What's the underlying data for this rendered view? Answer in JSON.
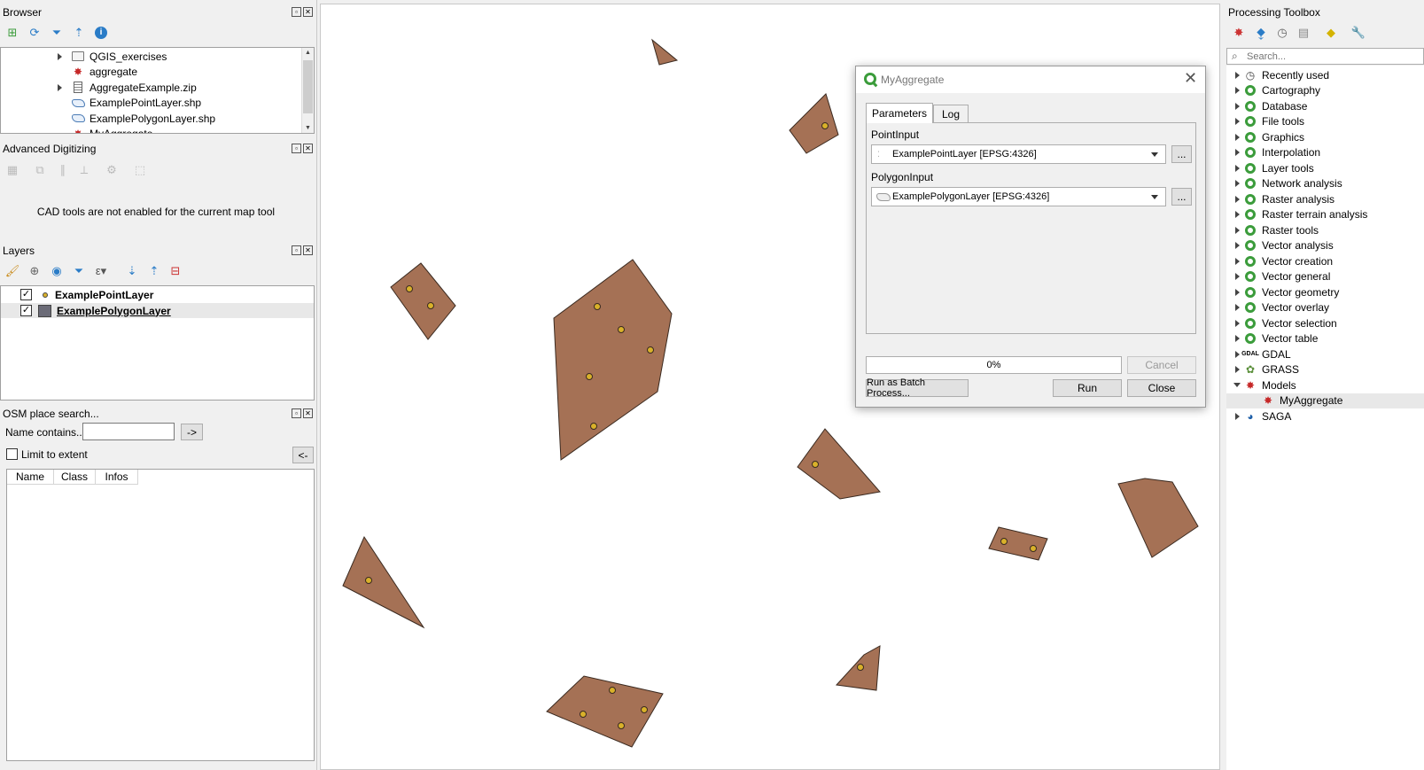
{
  "colors": {
    "polygon_fill": "#a57155",
    "point_fill": "#d9b12a",
    "accent_green": "#3b9c3b",
    "panel_bg": "#f0f0f0"
  },
  "browser": {
    "title": "Browser",
    "items": [
      {
        "label": "QGIS_exercises",
        "icon": "folder-icon",
        "expandable": true
      },
      {
        "label": "aggregate",
        "icon": "model-icon",
        "expandable": false
      },
      {
        "label": "AggregateExample.zip",
        "icon": "zip-icon",
        "expandable": true
      },
      {
        "label": "ExamplePointLayer.shp",
        "icon": "vector-icon",
        "expandable": false
      },
      {
        "label": "ExamplePolygonLayer.shp",
        "icon": "vector-icon",
        "expandable": false
      },
      {
        "label": "MyAggregate",
        "icon": "model-icon",
        "expandable": false
      }
    ]
  },
  "adv_digitizing": {
    "title": "Advanced Digitizing",
    "message": "CAD tools are not enabled for the current map tool"
  },
  "layers": {
    "title": "Layers",
    "items": [
      {
        "label": "ExamplePointLayer",
        "checked": "✓",
        "symbol": "point"
      },
      {
        "label": "ExamplePolygonLayer",
        "checked": "✓",
        "symbol": "polygon"
      }
    ]
  },
  "osm": {
    "title": "OSM place search...",
    "name_label": "Name contains...",
    "name_value": "",
    "go_button": "->",
    "limit_label": "Limit to extent",
    "back_button": "<-",
    "columns": [
      "Name",
      "Class",
      "Infos"
    ]
  },
  "dialog": {
    "title": "MyAggregate",
    "tabs": [
      "Parameters",
      "Log"
    ],
    "point_label": "PointInput",
    "point_value": "ExamplePointLayer [EPSG:4326]",
    "polygon_label": "PolygonInput",
    "polygon_value": "ExamplePolygonLayer [EPSG:4326]",
    "ellipsis": "...",
    "progress": "0%",
    "progress_fraction": 0,
    "cancel": "Cancel",
    "batch": "Run as Batch Process...",
    "run": "Run",
    "close": "Close"
  },
  "toolbox": {
    "title": "Processing Toolbox",
    "search_placeholder": "Search...",
    "items": [
      {
        "label": "Recently used",
        "icon": "clock-icon",
        "expanded": false
      },
      {
        "label": "Cartography",
        "icon": "qgis-icon",
        "expanded": false
      },
      {
        "label": "Database",
        "icon": "qgis-icon",
        "expanded": false
      },
      {
        "label": "File tools",
        "icon": "qgis-icon",
        "expanded": false
      },
      {
        "label": "Graphics",
        "icon": "qgis-icon",
        "expanded": false
      },
      {
        "label": "Interpolation",
        "icon": "qgis-icon",
        "expanded": false
      },
      {
        "label": "Layer tools",
        "icon": "qgis-icon",
        "expanded": false
      },
      {
        "label": "Network analysis",
        "icon": "qgis-icon",
        "expanded": false
      },
      {
        "label": "Raster analysis",
        "icon": "qgis-icon",
        "expanded": false
      },
      {
        "label": "Raster terrain analysis",
        "icon": "qgis-icon",
        "expanded": false
      },
      {
        "label": "Raster tools",
        "icon": "qgis-icon",
        "expanded": false
      },
      {
        "label": "Vector analysis",
        "icon": "qgis-icon",
        "expanded": false
      },
      {
        "label": "Vector creation",
        "icon": "qgis-icon",
        "expanded": false
      },
      {
        "label": "Vector general",
        "icon": "qgis-icon",
        "expanded": false
      },
      {
        "label": "Vector geometry",
        "icon": "qgis-icon",
        "expanded": false
      },
      {
        "label": "Vector overlay",
        "icon": "qgis-icon",
        "expanded": false
      },
      {
        "label": "Vector selection",
        "icon": "qgis-icon",
        "expanded": false
      },
      {
        "label": "Vector table",
        "icon": "qgis-icon",
        "expanded": false
      },
      {
        "label": "GDAL",
        "icon": "gdal-icon",
        "expanded": false
      },
      {
        "label": "GRASS",
        "icon": "grass-icon",
        "expanded": false
      },
      {
        "label": "Models",
        "icon": "model-icon",
        "expanded": true
      },
      {
        "label": "MyAggregate",
        "icon": "model-icon",
        "expanded": false,
        "child": true
      },
      {
        "label": "SAGA",
        "icon": "saga-icon",
        "expanded": false
      }
    ]
  }
}
